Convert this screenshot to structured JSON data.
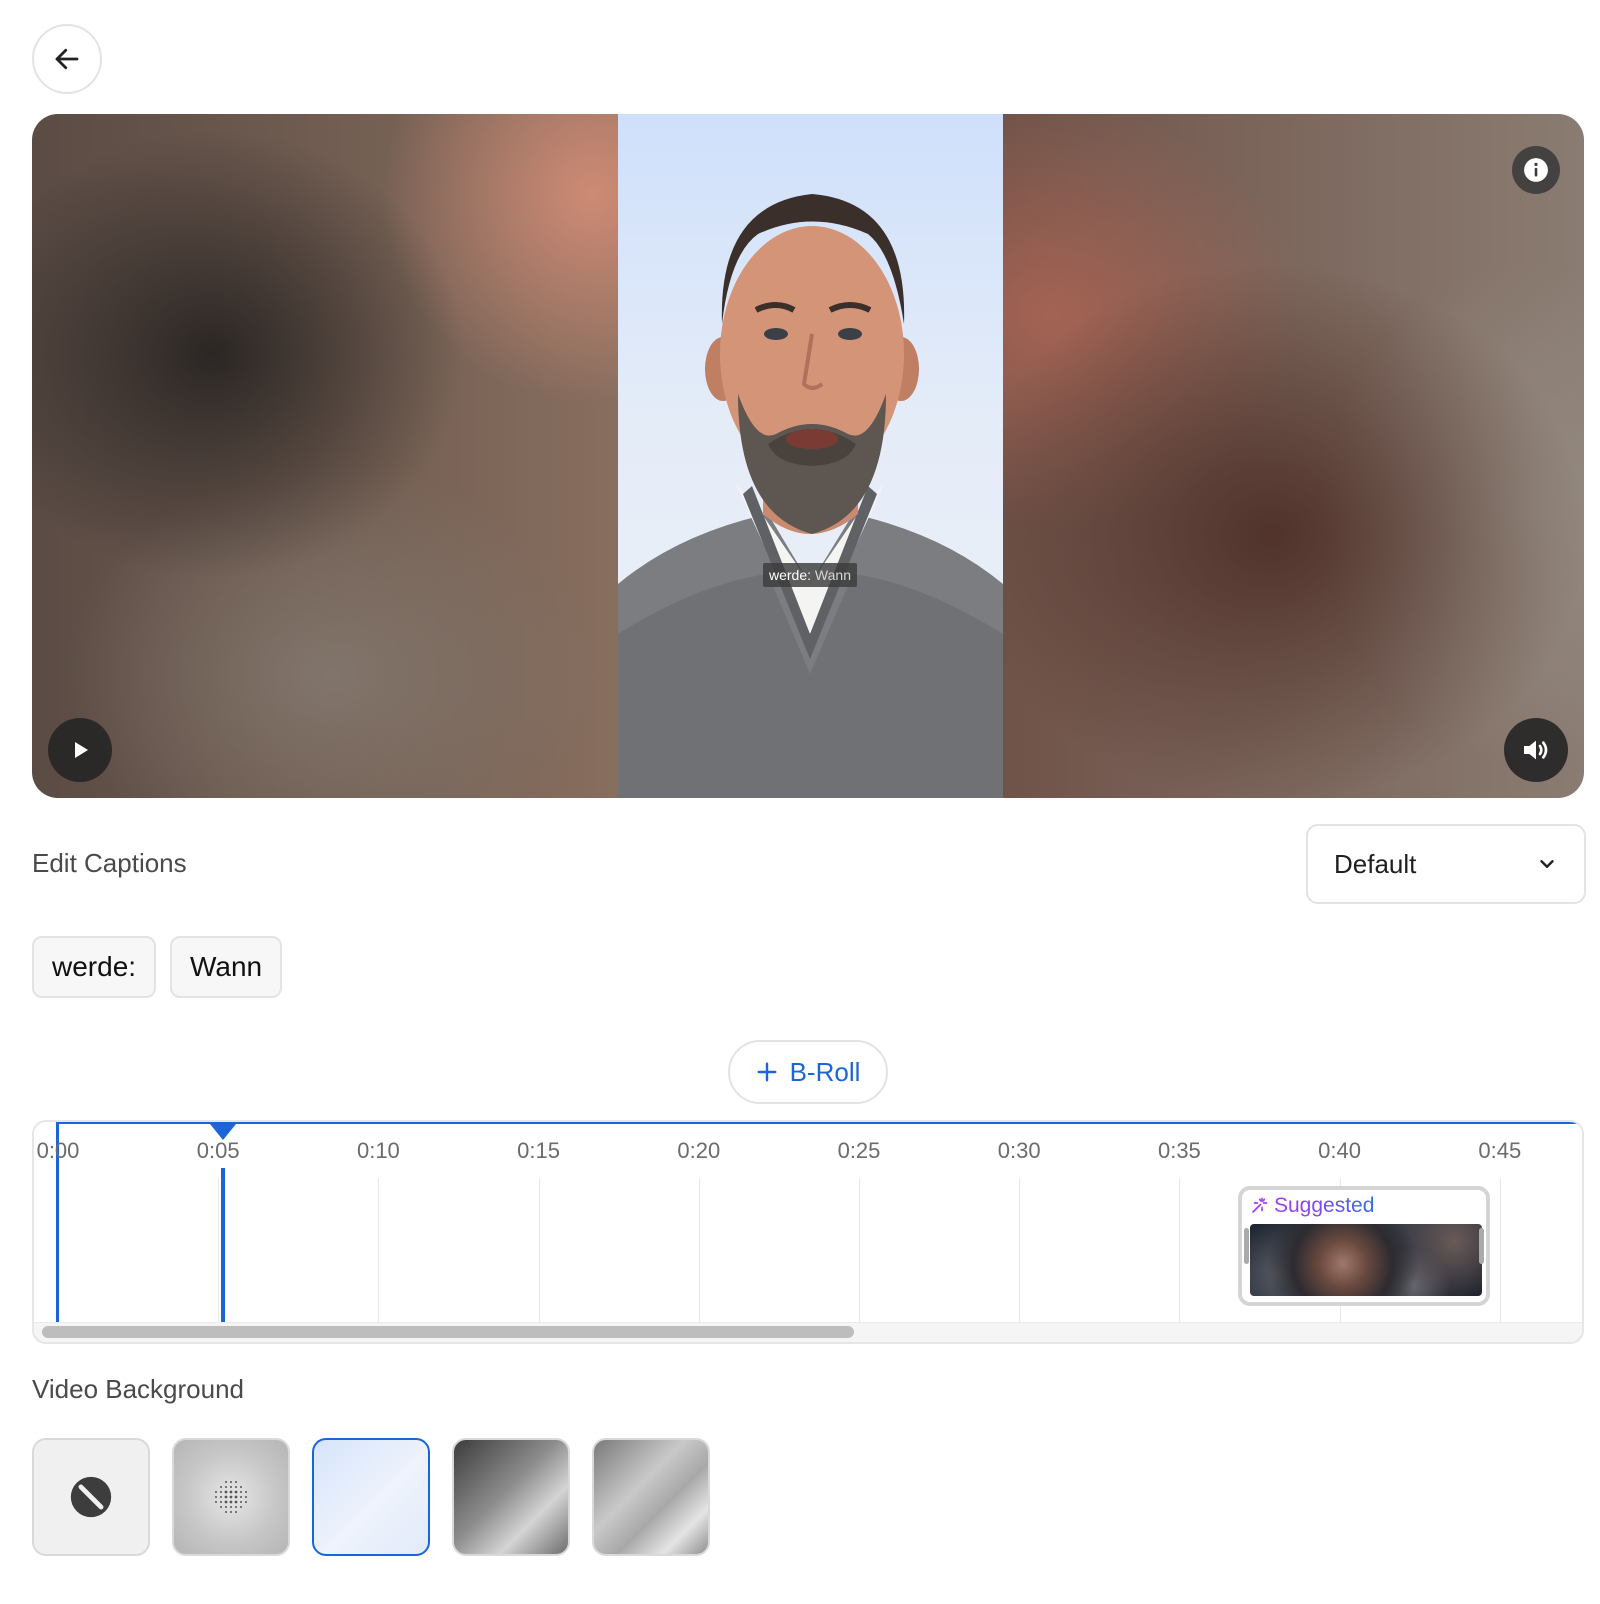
{
  "nav": {
    "back_icon": "arrow-left-icon"
  },
  "player": {
    "caption_overlay": {
      "word1": "werde:",
      "word2": "Wann"
    },
    "info_icon": "info-icon",
    "play_icon": "play-icon",
    "volume_icon": "volume-icon"
  },
  "captions": {
    "title": "Edit Captions",
    "style_select": {
      "value": "Default",
      "icon": "chevron-down-icon"
    },
    "words": [
      "werde:",
      "Wann"
    ]
  },
  "broll": {
    "button_label": "B-Roll",
    "icon": "plus-icon"
  },
  "timeline": {
    "ticks": [
      "0:00",
      "0:05",
      "0:10",
      "0:15",
      "0:20",
      "0:25",
      "0:30",
      "0:35",
      "0:40",
      "0:45"
    ],
    "playhead_time": "0:05",
    "clip": {
      "label": "Suggested",
      "icon": "magic-sparkle-icon",
      "start": "0:37.5",
      "end": "0:45.5"
    }
  },
  "background": {
    "title": "Video Background",
    "options": [
      {
        "name": "none",
        "icon": "no-background-icon"
      },
      {
        "name": "dot-pattern",
        "icon": "dots-icon"
      },
      {
        "name": "light-blue-gradient",
        "selected": true
      },
      {
        "name": "dark-gray-gradient"
      },
      {
        "name": "silver-gradient"
      }
    ]
  },
  "colors": {
    "accent": "#1a66d8",
    "suggested_purple": "#a23cf0"
  }
}
